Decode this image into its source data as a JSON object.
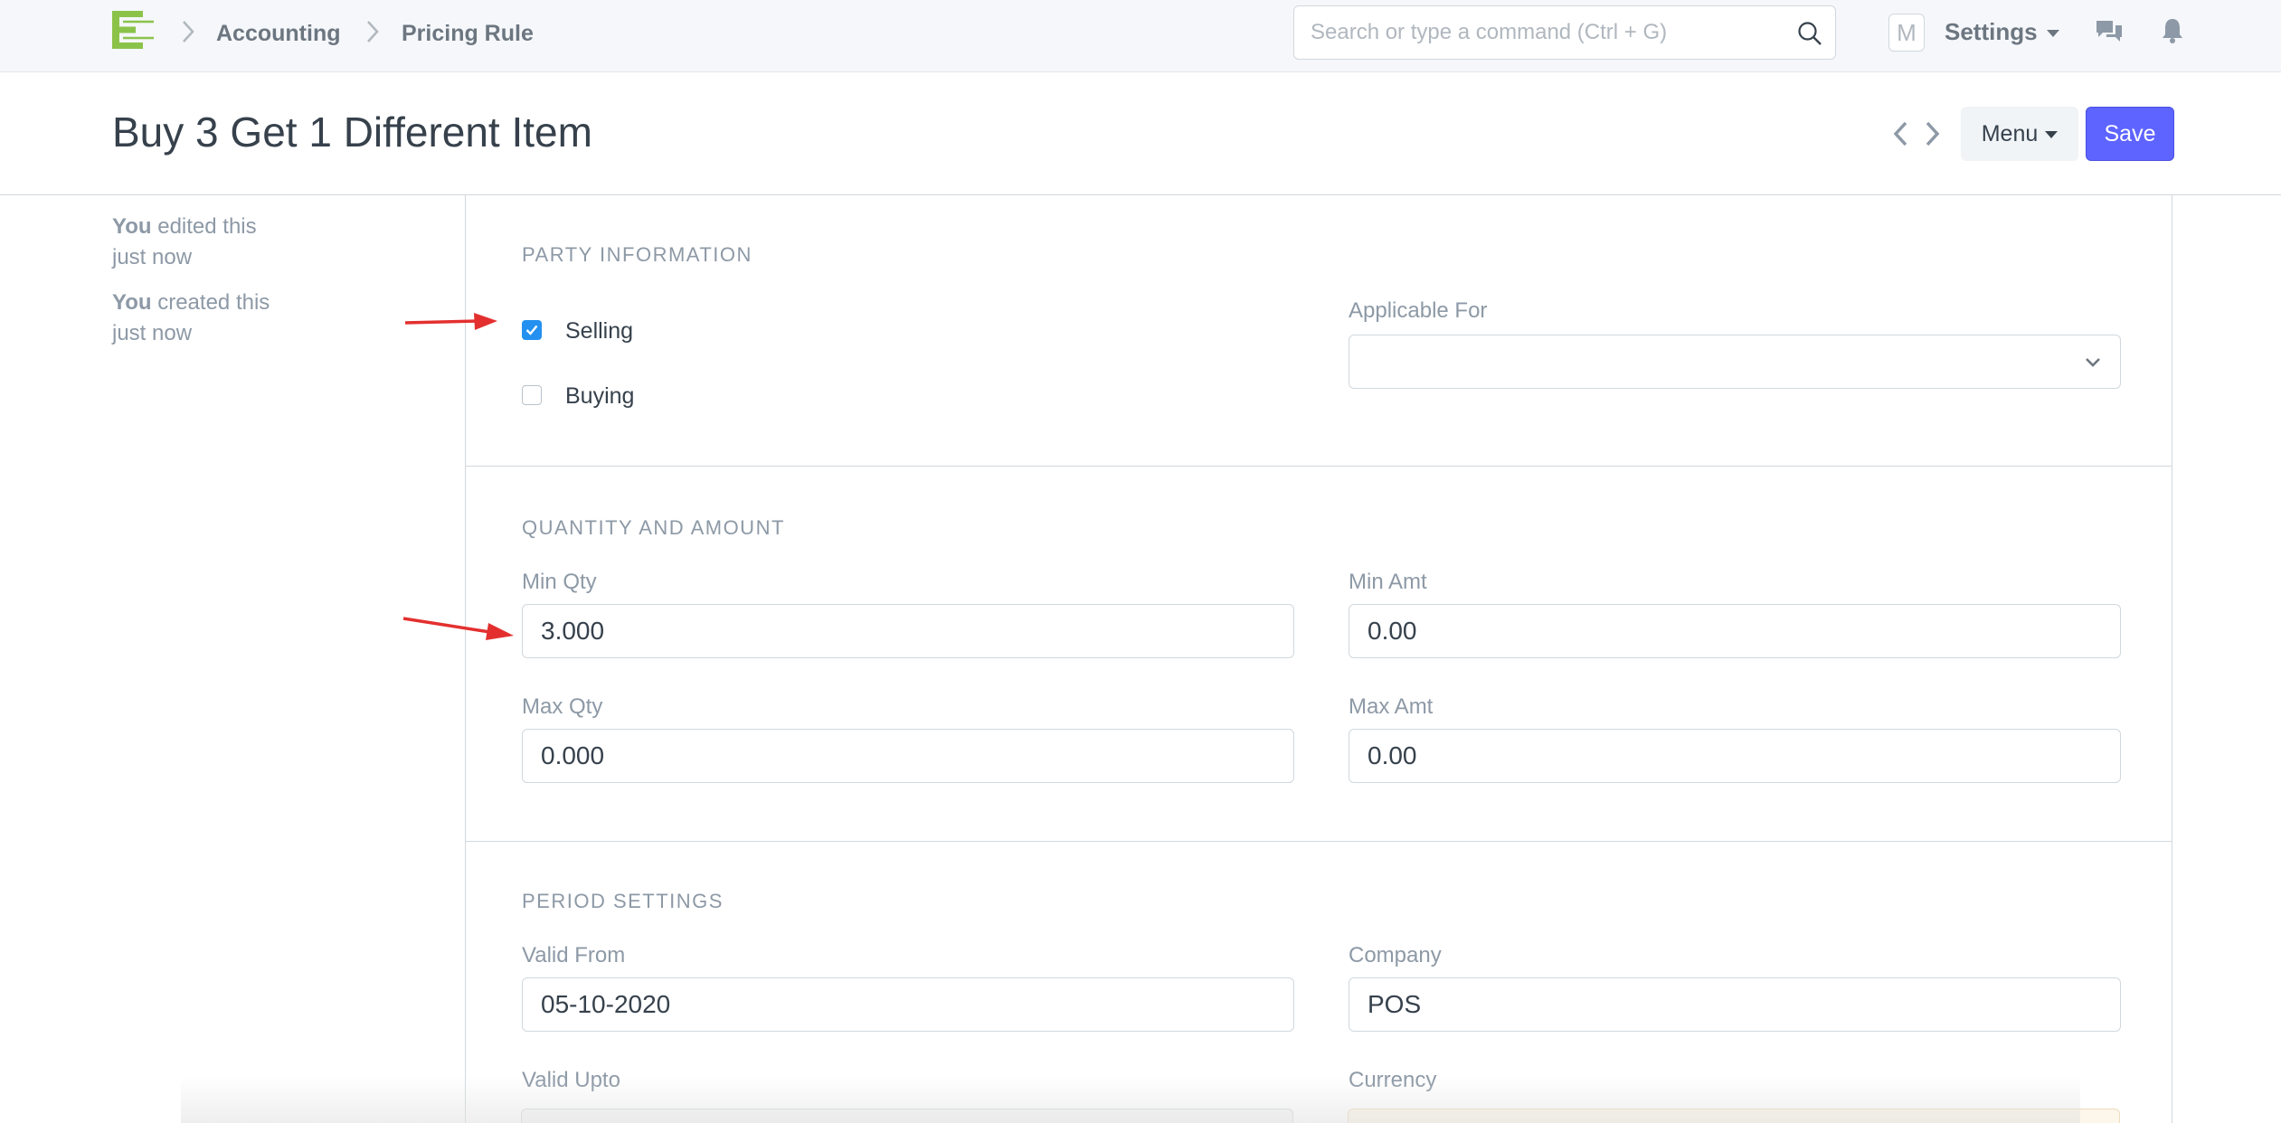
{
  "breadcrumbs": [
    "Accounting",
    "Pricing Rule"
  ],
  "search": {
    "placeholder": "Search or type a command (Ctrl + G)"
  },
  "user": {
    "avatar_letter": "M",
    "settings_label": "Settings"
  },
  "page": {
    "title": "Buy 3 Get 1 Different Item",
    "menu_label": "Menu",
    "save_label": "Save"
  },
  "timeline": [
    {
      "actor": "You",
      "action": "edited this",
      "time": "just now"
    },
    {
      "actor": "You",
      "action": "created this",
      "time": "just now"
    }
  ],
  "sections": {
    "party": {
      "title": "PARTY INFORMATION",
      "selling": {
        "label": "Selling",
        "checked": true
      },
      "buying": {
        "label": "Buying",
        "checked": false
      },
      "applicable_for": {
        "label": "Applicable For",
        "value": ""
      }
    },
    "qty": {
      "title": "QUANTITY AND AMOUNT",
      "min_qty": {
        "label": "Min Qty",
        "value": "3.000"
      },
      "min_amt": {
        "label": "Min Amt",
        "value": "0.00"
      },
      "max_qty": {
        "label": "Max Qty",
        "value": "0.000"
      },
      "max_amt": {
        "label": "Max Amt",
        "value": "0.00"
      }
    },
    "period": {
      "title": "PERIOD SETTINGS",
      "valid_from": {
        "label": "Valid From",
        "value": "05-10-2020"
      },
      "company": {
        "label": "Company",
        "value": "POS"
      },
      "valid_upto": {
        "label": "Valid Upto",
        "value": ""
      },
      "currency": {
        "label": "Currency",
        "value": ""
      }
    }
  },
  "colors": {
    "primary": "#5e64ff",
    "checkbox": "#2490ef",
    "logo_green": "#8bc34a",
    "annotation_arrow": "#e3302f"
  }
}
